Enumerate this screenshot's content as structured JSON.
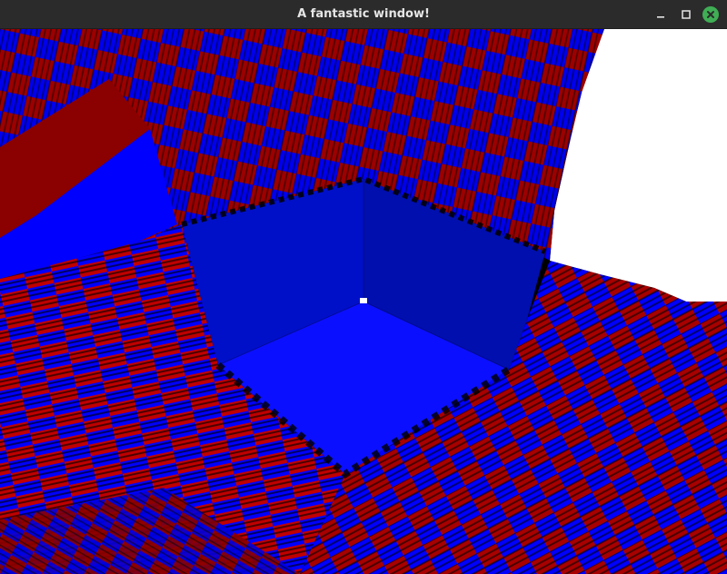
{
  "window": {
    "title": "A fantastic window!",
    "controls": {
      "minimize_icon": "minimize-icon",
      "maximize_icon": "maximize-icon",
      "close_icon": "close-icon",
      "close_color": "#3fae55"
    }
  },
  "scene": {
    "colors": {
      "checker_blue": "#0000ff",
      "checker_red": "#b20000",
      "dark_red": "#8b0000",
      "wall_left": "#0010c8",
      "wall_right": "#000fae",
      "floor": "#0a10ff",
      "sky": "#ffffff",
      "shadow": "#000000"
    }
  }
}
